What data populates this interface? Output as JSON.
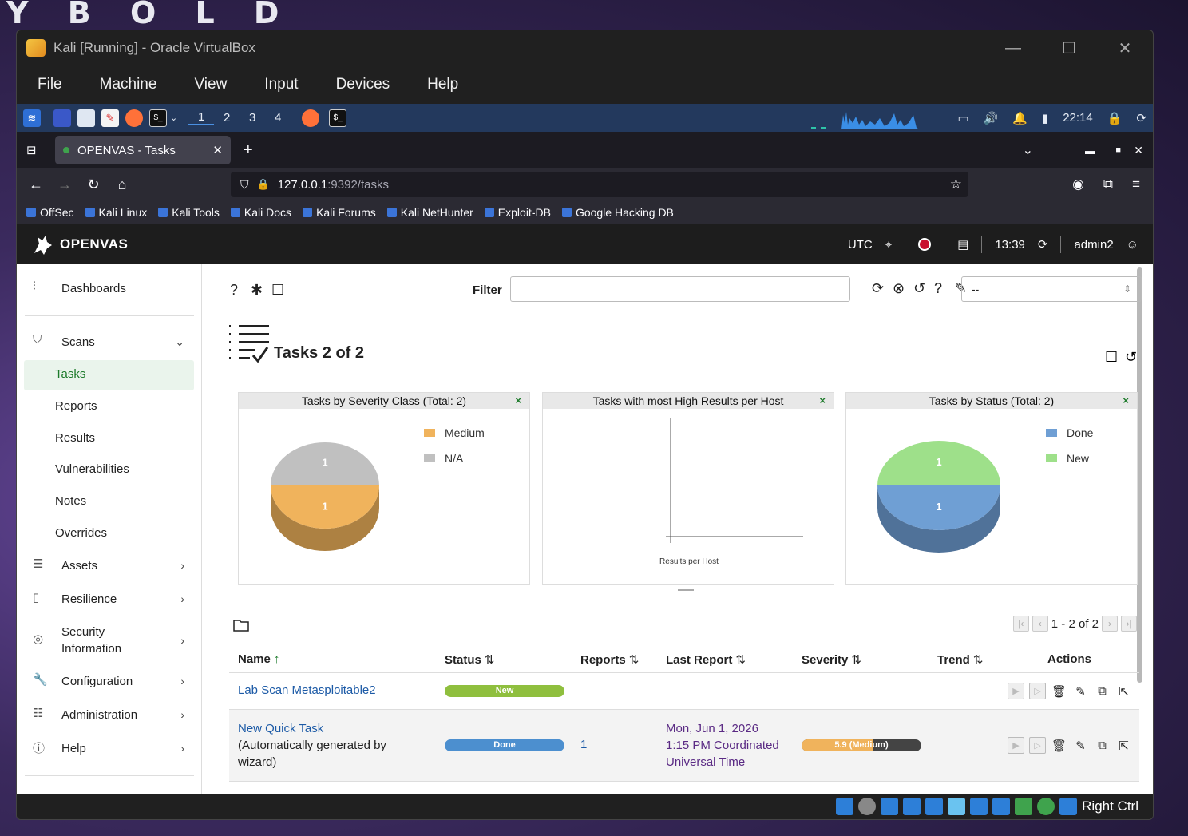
{
  "desktop": {
    "bg_text": "Y B O L D"
  },
  "vbox": {
    "title": "Kali [Running] - Oracle VirtualBox",
    "menu": [
      "File",
      "Machine",
      "View",
      "Input",
      "Devices",
      "Help"
    ],
    "status_key": "Right Ctrl"
  },
  "kali_panel": {
    "workspaces": [
      "1",
      "2",
      "3",
      "4"
    ],
    "clock": "22:14"
  },
  "firefox": {
    "tab_title": "OPENVAS - Tasks",
    "url_host": "127.0.0.1",
    "url_path": ":9392/tasks",
    "bookmarks": [
      "OffSec",
      "Kali Linux",
      "Kali Tools",
      "Kali Docs",
      "Kali Forums",
      "Kali NetHunter",
      "Exploit-DB",
      "Google Hacking DB"
    ]
  },
  "openvas": {
    "brand": "OPENVAS",
    "timezone": "UTC",
    "time": "13:39",
    "user": "admin2",
    "sidebar": {
      "dashboards": "Dashboards",
      "scans": "Scans",
      "scans_sub": [
        "Tasks",
        "Reports",
        "Results",
        "Vulnerabilities",
        "Notes",
        "Overrides"
      ],
      "assets": "Assets",
      "resilience": "Resilience",
      "security_info_1": "Security",
      "security_info_2": "Information",
      "configuration": "Configuration",
      "administration": "Administration",
      "help": "Help"
    },
    "filter_label": "Filter",
    "filter_select": "--",
    "page_title": "Tasks 2 of 2",
    "dashboards": [
      {
        "title": "Tasks by Severity Class (Total: 2)",
        "legend": [
          "Medium",
          "N/A"
        ]
      },
      {
        "title": "Tasks with most High Results per Host",
        "xlabel": "Results per Host"
      },
      {
        "title": "Tasks by Status (Total: 2)",
        "legend": [
          "Done",
          "New"
        ]
      }
    ],
    "pager": "1 - 2 of 2",
    "columns": {
      "name": "Name",
      "status": "Status",
      "reports": "Reports",
      "last_report": "Last Report",
      "severity": "Severity",
      "trend": "Trend",
      "actions": "Actions"
    },
    "rows": [
      {
        "name": "Lab Scan Metasploitable2",
        "status": "New",
        "reports": "",
        "last_report": "",
        "severity": ""
      },
      {
        "name": "New Quick Task",
        "comment_1": "(Automatically generated by",
        "comment_2": "wizard)",
        "status": "Done",
        "reports": "1",
        "last_report_1": "Mon, Jun 1, 2026",
        "last_report_2": "1:15 PM Coordinated",
        "last_report_3": "Universal Time",
        "severity": "5.9 (Medium)"
      }
    ]
  },
  "chart_data": [
    {
      "type": "pie",
      "title": "Tasks by Severity Class (Total: 2)",
      "categories": [
        "Medium",
        "N/A"
      ],
      "values": [
        1,
        1
      ],
      "colors": [
        "#f0b35c",
        "#c0c0c0"
      ]
    },
    {
      "type": "bar",
      "title": "Tasks with most High Results per Host",
      "categories": [],
      "values": [],
      "xlabel": "Results per Host"
    },
    {
      "type": "pie",
      "title": "Tasks by Status (Total: 2)",
      "categories": [
        "Done",
        "New"
      ],
      "values": [
        1,
        1
      ],
      "colors": [
        "#6f9fd4",
        "#9ee08a"
      ]
    }
  ]
}
